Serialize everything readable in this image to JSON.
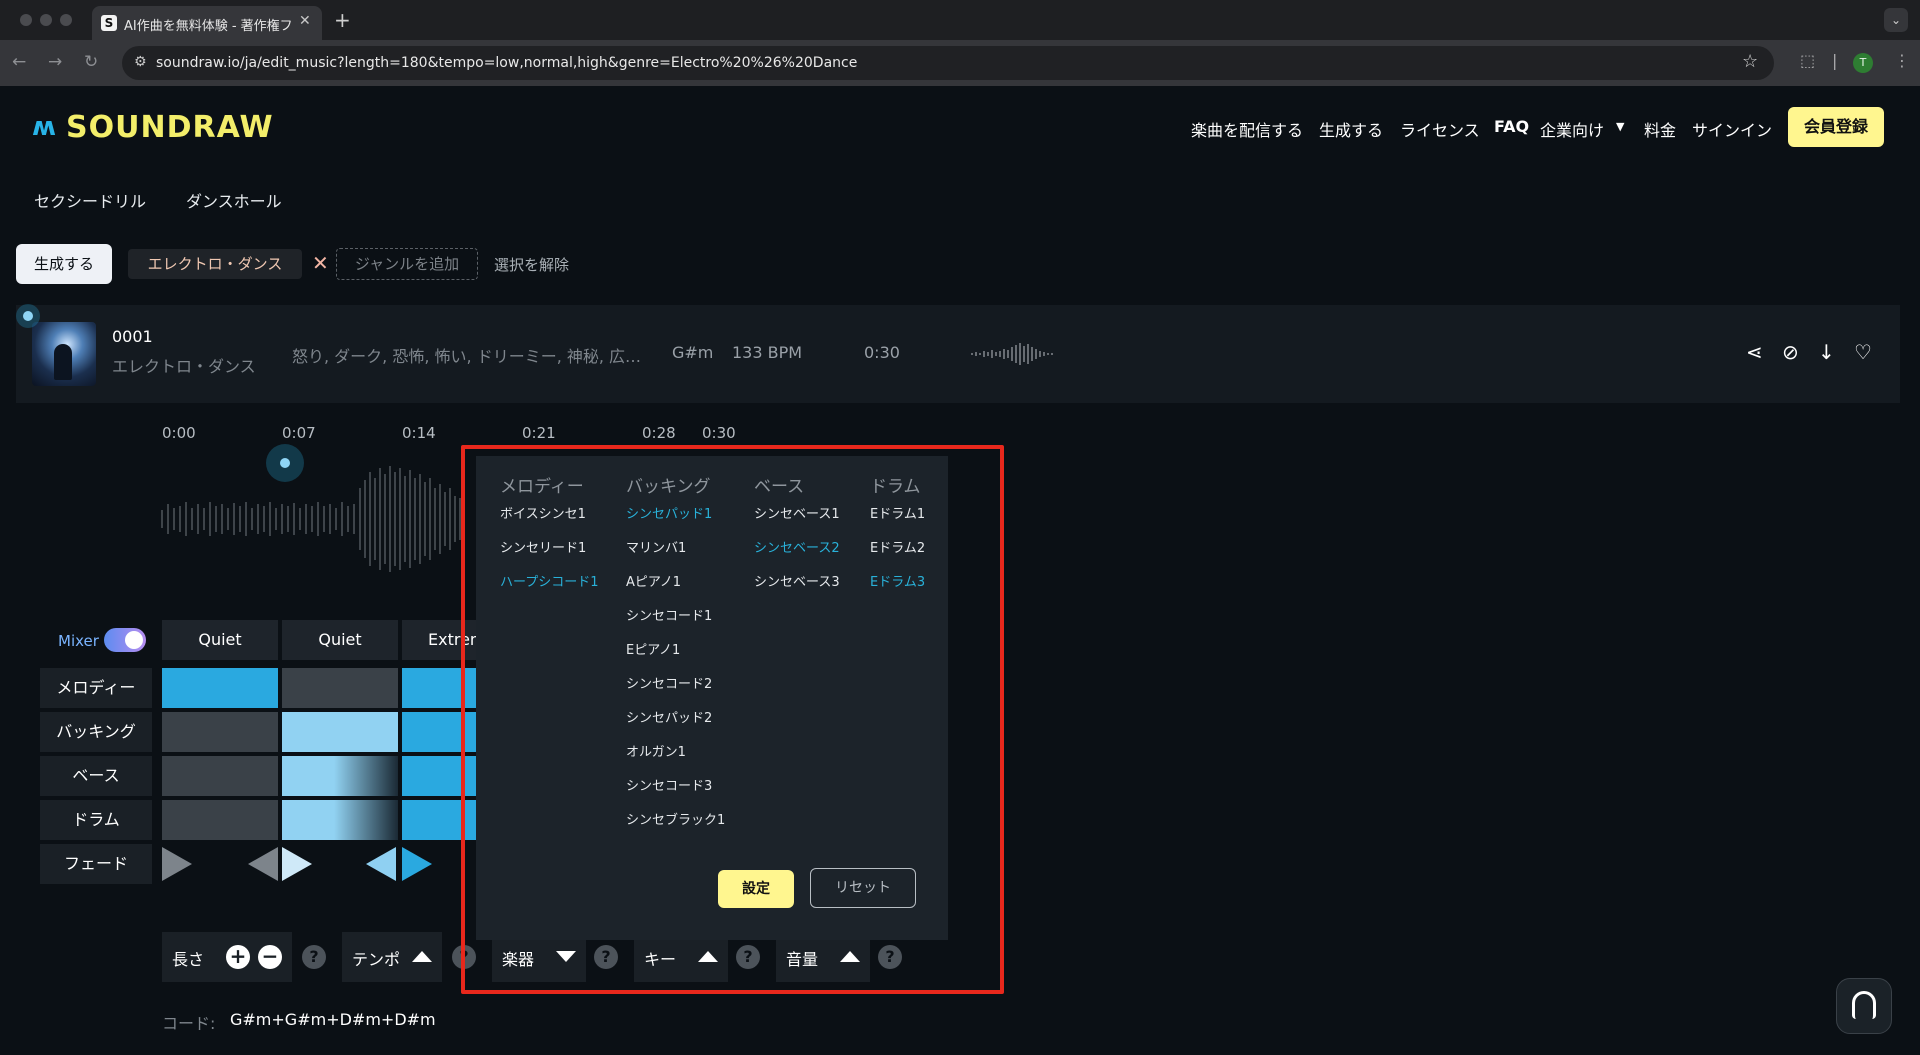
{
  "browser": {
    "tab_favicon": "S",
    "tab_title": "AI作曲を無料体験 - 著作権フリー",
    "url": "soundraw.io/ja/edit_music?length=180&tempo=low,normal,high&genre=Electro%20%26%20Dance",
    "avatar_letter": "T"
  },
  "header": {
    "logo_text": "SOUNDRAW",
    "nav": [
      "楽曲を配信する",
      "生成する",
      "ライセンス",
      "FAQ",
      "企業向け",
      "料金",
      "サインイン"
    ],
    "member_button": "会員登録",
    "subnav": [
      "セクシードリル",
      "ダンスホール"
    ]
  },
  "filters": {
    "generate_button": "生成する",
    "genre_chip": "エレクトロ・ダンス",
    "remove_icon": "✕",
    "add_genre": "ジャンルを追加",
    "clear_selection": "選択を解除"
  },
  "track": {
    "number": "0001",
    "genre": "エレクトロ・ダンス",
    "moods": "怒り, ダーク, 恐怖, 怖い, ドリーミー, 神秘, 広…",
    "key": "G#m",
    "bpm": "133 BPM",
    "duration": "0:30"
  },
  "timeline": {
    "ticks": [
      "0:00",
      "0:07",
      "0:14",
      "0:21",
      "0:28",
      "0:30"
    ]
  },
  "mixer": {
    "label": "Mixer",
    "toggle_on": true,
    "presets": [
      "Quiet",
      "Quiet",
      "Extrem"
    ],
    "tracks": [
      "メロディー",
      "バッキング",
      "ベース",
      "ドラム"
    ],
    "fade_label": "フェード"
  },
  "controls": {
    "length": "長さ",
    "tempo": "テンポ",
    "instruments": "楽器",
    "key": "キー",
    "volume": "音量",
    "help": "?",
    "plus": "+",
    "minus": "−"
  },
  "chord": {
    "label": "コード:",
    "value": "G#m+G#m+D#m+D#m"
  },
  "instrument_popup": {
    "columns": [
      {
        "title": "メロディー",
        "items": [
          "ボイスシンセ1",
          "シンセリード1",
          "ハープシコード1"
        ],
        "selected": [
          2
        ]
      },
      {
        "title": "バッキング",
        "items": [
          "シンセパッド1",
          "マリンバ1",
          "Aピアノ1",
          "シンセコード1",
          "Eピアノ1",
          "シンセコード2",
          "シンセパッド2",
          "オルガン1",
          "シンセコード3",
          "シンセブラック1"
        ],
        "selected": [
          0
        ]
      },
      {
        "title": "ベース",
        "items": [
          "シンセベース1",
          "シンセベース2",
          "シンセベース3"
        ],
        "selected": [
          1
        ]
      },
      {
        "title": "ドラム",
        "items": [
          "Eドラム1",
          "Eドラム2",
          "Eドラム3"
        ],
        "selected": [
          2
        ]
      }
    ],
    "set_button": "設定",
    "reset_button": "リセット"
  },
  "colors": {
    "accent_blue": "#2aa9e0",
    "selected_instrument": "#29b1d9",
    "brand_yellow": "#fff68f",
    "highlight_red": "#e8281c"
  }
}
